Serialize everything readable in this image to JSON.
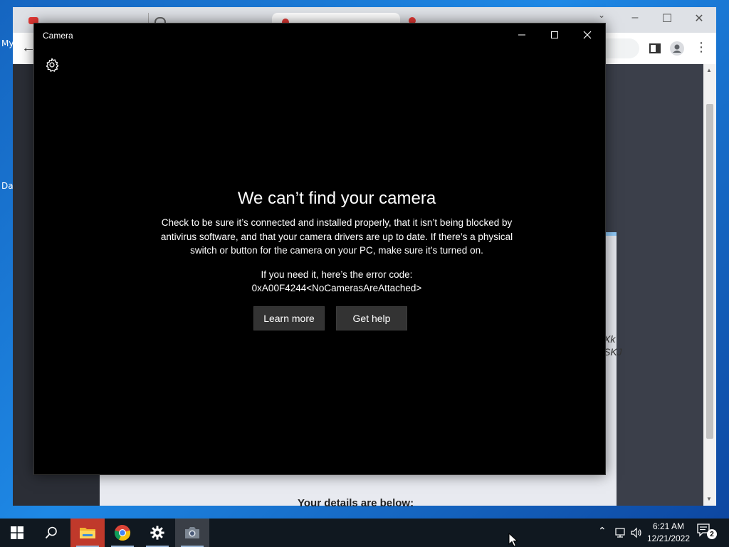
{
  "desktop": {
    "labels": [
      "My",
      "Da"
    ]
  },
  "browser": {
    "details_text": "Your details are below:",
    "side_text": [
      "Xk",
      "SKJ"
    ]
  },
  "camera_window": {
    "title": "Camera",
    "heading": "We can’t find your camera",
    "body": "Check to be sure it’s connected and installed properly, that it isn’t being blocked by antivirus software, and that your camera drivers are up to date. If there’s a physical switch or button for the camera on your PC, make sure it’s turned on.",
    "error_label": "If you need it, here’s the error code:",
    "error_code": "0xA00F4244<NoCamerasAreAttached>",
    "buttons": {
      "learn_more": "Learn more",
      "get_help": "Get help"
    }
  },
  "taskbar": {
    "pinned": [
      "start",
      "search",
      "file-explorer",
      "chrome",
      "settings",
      "camera"
    ],
    "clock": {
      "time": "6:21 AM",
      "date": "12/21/2022"
    },
    "notification_count": "2"
  },
  "colors": {
    "camera_bg": "#000000",
    "button_bg": "#333333",
    "taskbar_bg": "#101820",
    "desktop_accent": "#1e88e5"
  }
}
